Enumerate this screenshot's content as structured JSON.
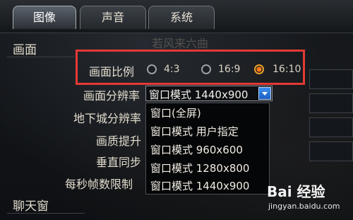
{
  "tabs": [
    {
      "label": "图像",
      "active": true
    },
    {
      "label": "声音",
      "active": false
    },
    {
      "label": "系统",
      "active": false
    }
  ],
  "sections": {
    "display": "画面",
    "chat": "聊天窗"
  },
  "background_text": "若风来六曲",
  "aspect_ratio": {
    "label": "画面比例",
    "options": [
      "4:3",
      "16:9",
      "16:10"
    ],
    "selected": "16:10"
  },
  "resolution": {
    "label": "画面分辨率",
    "value": "窗口模式 1440x900",
    "options": [
      "窗口(全屏)",
      "窗口模式 用户指定",
      "窗口模式 960x600",
      "窗口模式 1280x800",
      "窗口模式 1440x900"
    ]
  },
  "labels": {
    "dungeon_resolution": "地下城分辨率",
    "quality_boost": "画质提升",
    "vsync": "垂直同步",
    "fps_limit": "每秒帧数限制"
  },
  "watermark": {
    "main": "Bai 经验",
    "sub": "jingyan.baidu.com"
  },
  "colors": {
    "highlight_border": "#e53935",
    "radio_selected": "#ff7a1a",
    "dropdown_arrow": "#1c5fc0"
  }
}
